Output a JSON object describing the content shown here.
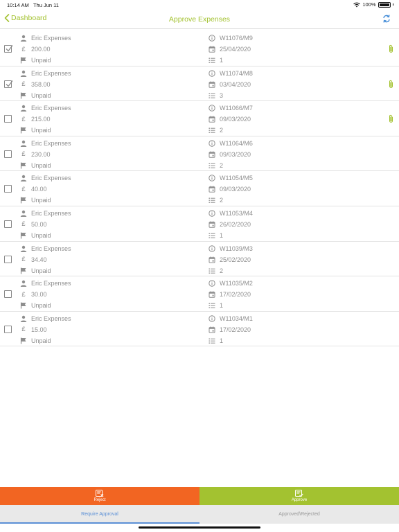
{
  "status_bar": {
    "time": "10:14 AM",
    "date": "Thu Jun 11",
    "battery": "100%"
  },
  "nav": {
    "back_label": "Dashboard",
    "title": "Approve Expenses"
  },
  "colors": {
    "accent_green": "#a3c230",
    "reject_orange": "#f26522",
    "tab_blue": "#5a8fd6"
  },
  "expenses": [
    {
      "name": "Eric Expenses",
      "amount": "200.00",
      "status": "Unpaid",
      "ref": "W11076/M9",
      "date": "25/04/2020",
      "count": "1",
      "checked": true,
      "attachment": true
    },
    {
      "name": "Eric Expenses",
      "amount": "358.00",
      "status": "Unpaid",
      "ref": "W11074/M8",
      "date": "03/04/2020",
      "count": "3",
      "checked": true,
      "attachment": true
    },
    {
      "name": "Eric Expenses",
      "amount": "215.00",
      "status": "Unpaid",
      "ref": "W11066/M7",
      "date": "09/03/2020",
      "count": "2",
      "checked": false,
      "attachment": true
    },
    {
      "name": "Eric Expenses",
      "amount": "230.00",
      "status": "Unpaid",
      "ref": "W11064/M6",
      "date": "09/03/2020",
      "count": "2",
      "checked": false,
      "attachment": false
    },
    {
      "name": "Eric Expenses",
      "amount": "40.00",
      "status": "Unpaid",
      "ref": "W11054/M5",
      "date": "09/03/2020",
      "count": "2",
      "checked": false,
      "attachment": false
    },
    {
      "name": "Eric Expenses",
      "amount": "50.00",
      "status": "Unpaid",
      "ref": "W11053/M4",
      "date": "26/02/2020",
      "count": "1",
      "checked": false,
      "attachment": false
    },
    {
      "name": "Eric Expenses",
      "amount": "34.40",
      "status": "Unpaid",
      "ref": "W11039/M3",
      "date": "25/02/2020",
      "count": "2",
      "checked": false,
      "attachment": false
    },
    {
      "name": "Eric Expenses",
      "amount": "30.00",
      "status": "Unpaid",
      "ref": "W11035/M2",
      "date": "17/02/2020",
      "count": "1",
      "checked": false,
      "attachment": false
    },
    {
      "name": "Eric Expenses",
      "amount": "15.00",
      "status": "Unpaid",
      "ref": "W11034/M1",
      "date": "17/02/2020",
      "count": "1",
      "checked": false,
      "attachment": false
    }
  ],
  "actions": {
    "reject_label": "Reject",
    "approve_label": "Approve"
  },
  "tabs": [
    {
      "label": "Require Approval",
      "active": true
    },
    {
      "label": "Approved\\Rejected",
      "active": false
    }
  ]
}
